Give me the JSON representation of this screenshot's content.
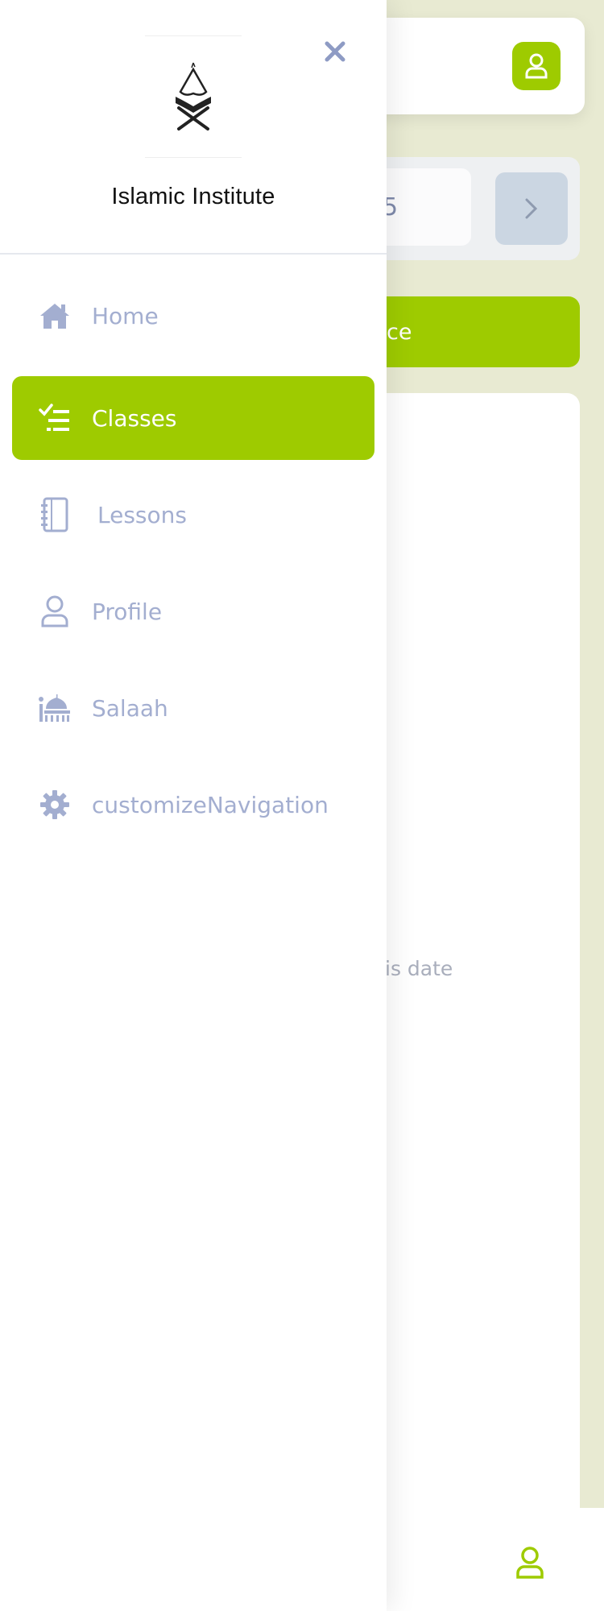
{
  "background": {
    "date_partial": "5",
    "action_button_partial": "ce",
    "empty_state_partial": "is date"
  },
  "drawer": {
    "org_name": "Islamic Institute",
    "items": [
      {
        "label": "Home",
        "icon": "home-icon",
        "active": false
      },
      {
        "label": "Classes",
        "icon": "checklist-icon",
        "active": true
      },
      {
        "label": "Lessons",
        "icon": "notebook-icon",
        "active": false
      },
      {
        "label": "Profile",
        "icon": "user-icon",
        "active": false
      },
      {
        "label": "Salaah",
        "icon": "mosque-icon",
        "active": false
      },
      {
        "label": "customizeNavigation",
        "icon": "gear-icon",
        "active": false
      }
    ]
  },
  "colors": {
    "accent": "#9ecb00",
    "nav_inactive": "#a3aed0",
    "page_bg": "#e8ead2"
  }
}
